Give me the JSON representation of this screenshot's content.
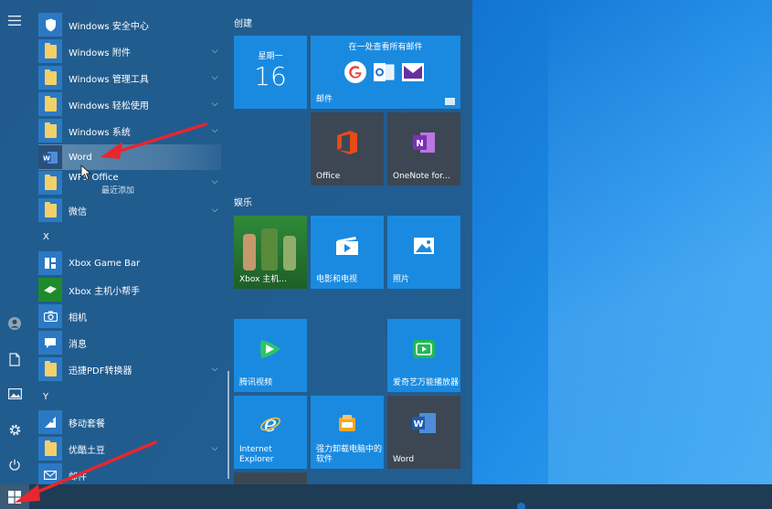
{
  "rail": {
    "menu_icon": "hamburger-icon",
    "account_icon": "user-icon",
    "documents_icon": "document-icon",
    "pictures_icon": "picture-icon",
    "settings_icon": "gear-icon",
    "power_icon": "power-icon"
  },
  "app_list": {
    "items": [
      {
        "label": "Windows 安全中心",
        "type": "app"
      },
      {
        "label": "Windows 附件",
        "type": "folder"
      },
      {
        "label": "Windows 管理工具",
        "type": "folder"
      },
      {
        "label": "Windows 轻松使用",
        "type": "folder"
      },
      {
        "label": "Windows 系统",
        "type": "folder"
      },
      {
        "label": "Word",
        "type": "app"
      },
      {
        "label": "WPS Office",
        "type": "folder",
        "sub": "最近添加"
      },
      {
        "label": "微信",
        "type": "folder"
      },
      {
        "label": "Xbox Game Bar",
        "type": "app"
      },
      {
        "label": "Xbox 主机小帮手",
        "type": "app"
      },
      {
        "label": "相机",
        "type": "app"
      },
      {
        "label": "消息",
        "type": "app"
      },
      {
        "label": "迅捷PDF转换器",
        "type": "folder"
      },
      {
        "label": "移动套餐",
        "type": "app"
      },
      {
        "label": "优酷土豆",
        "type": "folder"
      },
      {
        "label": "邮件",
        "type": "app"
      }
    ],
    "letters": [
      "X",
      "Y"
    ]
  },
  "tiles": {
    "group_create": "创建",
    "group_entertainment": "娱乐",
    "calendar_day": "星期一",
    "calendar_date": "16",
    "mail_header": "在一处查看所有邮件",
    "mail_label": "邮件",
    "office_label": "Office",
    "onenote_label": "OneNote for...",
    "xbox_label": "Xbox 主机...",
    "movies_label": "电影和电视",
    "photos_label": "照片",
    "tencent_label": "腾讯视频",
    "iqiyi_label": "爱奇艺万能播放器",
    "ie_label": "Internet Explorer",
    "uninstaller_label": "强力卸载电脑中的软件",
    "word_label": "Word"
  },
  "colors": {
    "accent": "#1a8ae0",
    "arrow": "#e8262d",
    "menu_bg": "#225c8c"
  }
}
